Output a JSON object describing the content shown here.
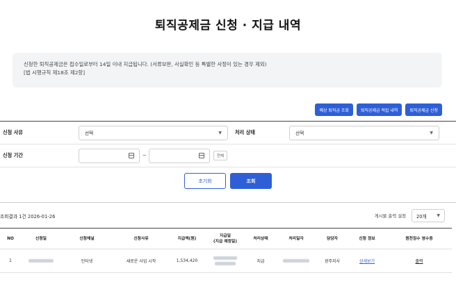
{
  "page": {
    "title": "퇴직공제금 신청 · 지급 내역"
  },
  "notice": {
    "line1": "신청한 퇴직공제금은 접수일로부터 14일 이내 지급됩니다. (서류보완, 사실확인 등 특별한 사정이 있는 경우 제외)",
    "line2": "[법 시행규칙 제18조 제2항]"
  },
  "top_buttons": {
    "estimate": "예상 퇴직금 조회",
    "accrual": "퇴직공제금 적립 내역",
    "apply": "퇴직공제금 신청"
  },
  "filter": {
    "reason_label": "신청 사유",
    "reason_value": "선택",
    "status_label": "처리 상태",
    "status_value": "선택",
    "period_label": "신청 기간",
    "period_sep": "~",
    "all_button": "전체"
  },
  "actions": {
    "reset": "초기화",
    "search": "조회"
  },
  "results": {
    "summary": "조회결과 1건 2026-01-26",
    "per_page_label": "게시물 출력 설정",
    "per_page_value": "20개"
  },
  "table": {
    "headers": {
      "no": "NO",
      "apply_date": "신청일",
      "channel": "신청채널",
      "reason": "신청사유",
      "amount": "지급액(원)",
      "pay_date_1": "지급일",
      "pay_date_2": "(지급 예정일)",
      "status": "처리상태",
      "process_date": "처리일자",
      "manager": "담당자",
      "info": "신청 정보",
      "receipt": "원천징수 영수증"
    },
    "rows": [
      {
        "no": "1",
        "channel": "인터넷",
        "reason": "새로운 사업 시작",
        "amount": "1,534,420",
        "status": "지급",
        "manager": "광주지사",
        "info": "상세보기",
        "receipt": "출력"
      }
    ]
  },
  "colors": {
    "accent": "#2f5fd7",
    "notice_bg": "#f3f4f6"
  }
}
